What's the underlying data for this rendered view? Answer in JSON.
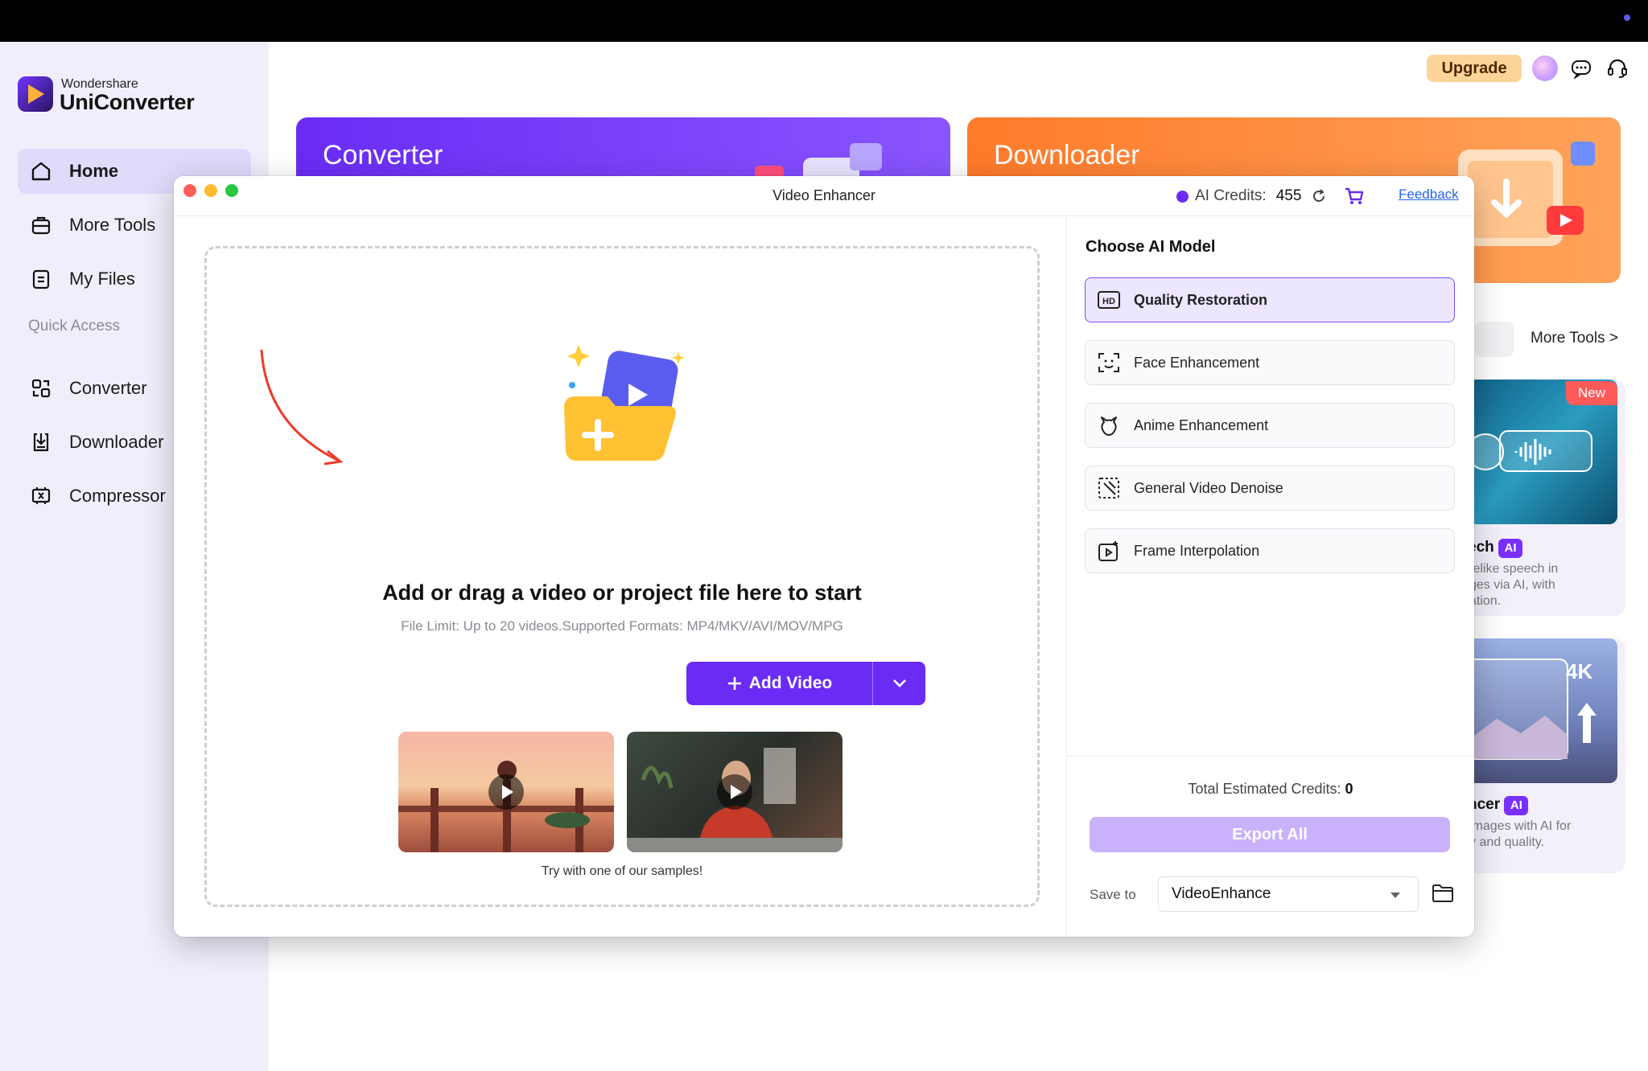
{
  "app": {
    "brand_small": "Wondershare",
    "brand_name": "UniConverter",
    "accent": "#6a2cf5"
  },
  "sidebar": {
    "items": [
      {
        "label": "Home",
        "icon": "home-icon",
        "active": true
      },
      {
        "label": "More Tools",
        "icon": "toolbox-icon"
      },
      {
        "label": "My Files",
        "icon": "file-icon"
      }
    ],
    "quick_access_label": "Quick Access",
    "quick_items": [
      {
        "label": "Converter",
        "icon": "converter-icon"
      },
      {
        "label": "Downloader",
        "icon": "downloader-icon"
      },
      {
        "label": "Compressor",
        "icon": "compressor-icon"
      }
    ]
  },
  "header": {
    "upgrade_label": "Upgrade",
    "icons": [
      "avatar",
      "message-icon",
      "headset-icon"
    ]
  },
  "cards": {
    "converter_title": "Converter",
    "downloader_title": "Downloader",
    "more_tools_link": "More Tools >",
    "new_badge": "New",
    "ai_badge": "AI",
    "fourk_badge": "4K",
    "peek1_title": "ech",
    "peek1_text": [
      "felike speech in",
      "ges via AI, with",
      "ation."
    ],
    "peek2_title": "ncer",
    "peek2_text": [
      "images with AI for",
      "y and quality."
    ]
  },
  "modal": {
    "window_title": "Video Enhancer",
    "credits_label": "AI Credits:",
    "credits_value": "455",
    "feedback_label": "Feedback",
    "drop_title": "Add or drag a video or project file here to start",
    "drop_limit": "File Limit: Up to 20 videos.Supported Formats: MP4/MKV/AVI/MOV/MPG",
    "add_video_label": "Add Video",
    "sample_caption": "Try with one of our samples!",
    "panel_title": "Choose AI Model",
    "models": [
      {
        "label": "Quality Restoration",
        "icon": "hd-icon",
        "selected": true
      },
      {
        "label": "Face Enhancement",
        "icon": "face-scan-icon"
      },
      {
        "label": "Anime Enhancement",
        "icon": "anime-icon"
      },
      {
        "label": "General Video Denoise",
        "icon": "denoise-icon"
      },
      {
        "label": "Frame Interpolation",
        "icon": "frame-interpolation-icon"
      }
    ],
    "total_label": "Total Estimated Credits:",
    "total_value": "0",
    "export_label": "Export All",
    "save_to_label": "Save to",
    "save_to_value": "VideoEnhance"
  }
}
